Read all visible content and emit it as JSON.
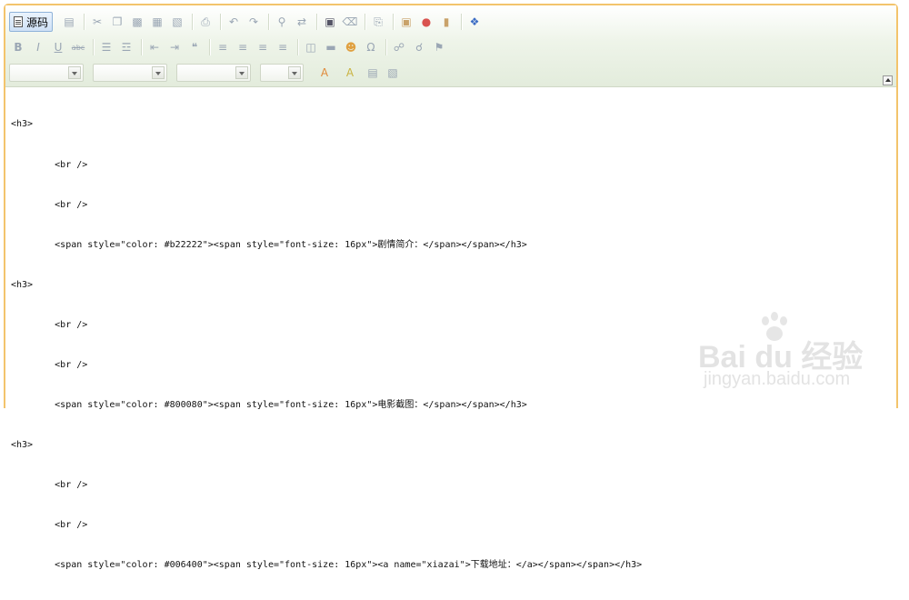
{
  "toolbar": {
    "source_label": "源码",
    "row1_icons": [
      "preview-icon",
      "cut-icon",
      "copy-icon",
      "paste-icon",
      "paste-text-icon",
      "paste-word-icon",
      "print-icon",
      "undo-icon",
      "redo-icon",
      "find-icon",
      "replace-icon",
      "select-all-icon",
      "remove-format-icon",
      "template-icon",
      "image-icon",
      "flash-icon",
      "table-icon",
      "maximize-icon"
    ],
    "format_buttons": {
      "bold": "B",
      "italic": "I",
      "underline": "U",
      "strike": "abc"
    },
    "row2_icons": [
      "ordered-list-icon",
      "unordered-list-icon",
      "outdent-icon",
      "indent-icon",
      "blockquote-icon",
      "align-left-icon",
      "align-center-icon",
      "align-right-icon",
      "align-justify-icon",
      "insert-table-icon",
      "horizontal-rule-icon",
      "smiley-icon",
      "special-char-icon",
      "link-icon",
      "unlink-icon",
      "anchor-icon"
    ],
    "row3_labels": {
      "text_color": "A",
      "bg_color": "A"
    }
  },
  "code_lines": [
    "<h3>",
    "        <br />",
    "        <br />",
    "        <span style=\"color: #b22222\"><span style=\"font-size: 16px\">剧情简介：</span></span></h3>",
    "<h3>",
    "        <br />",
    "        <br />",
    "        <span style=\"color: #800080\"><span style=\"font-size: 16px\">电影截图：</span></span></h3>",
    "<h3>",
    "        <br />",
    "        <br />",
    "        <span style=\"color: #006400\"><span style=\"font-size: 16px\"><a name=\"xiazai\">下载地址：</a></span></span></h3>"
  ],
  "watermark": {
    "logo": "Bai du 经验",
    "site": "jingyan.baidu.com"
  }
}
